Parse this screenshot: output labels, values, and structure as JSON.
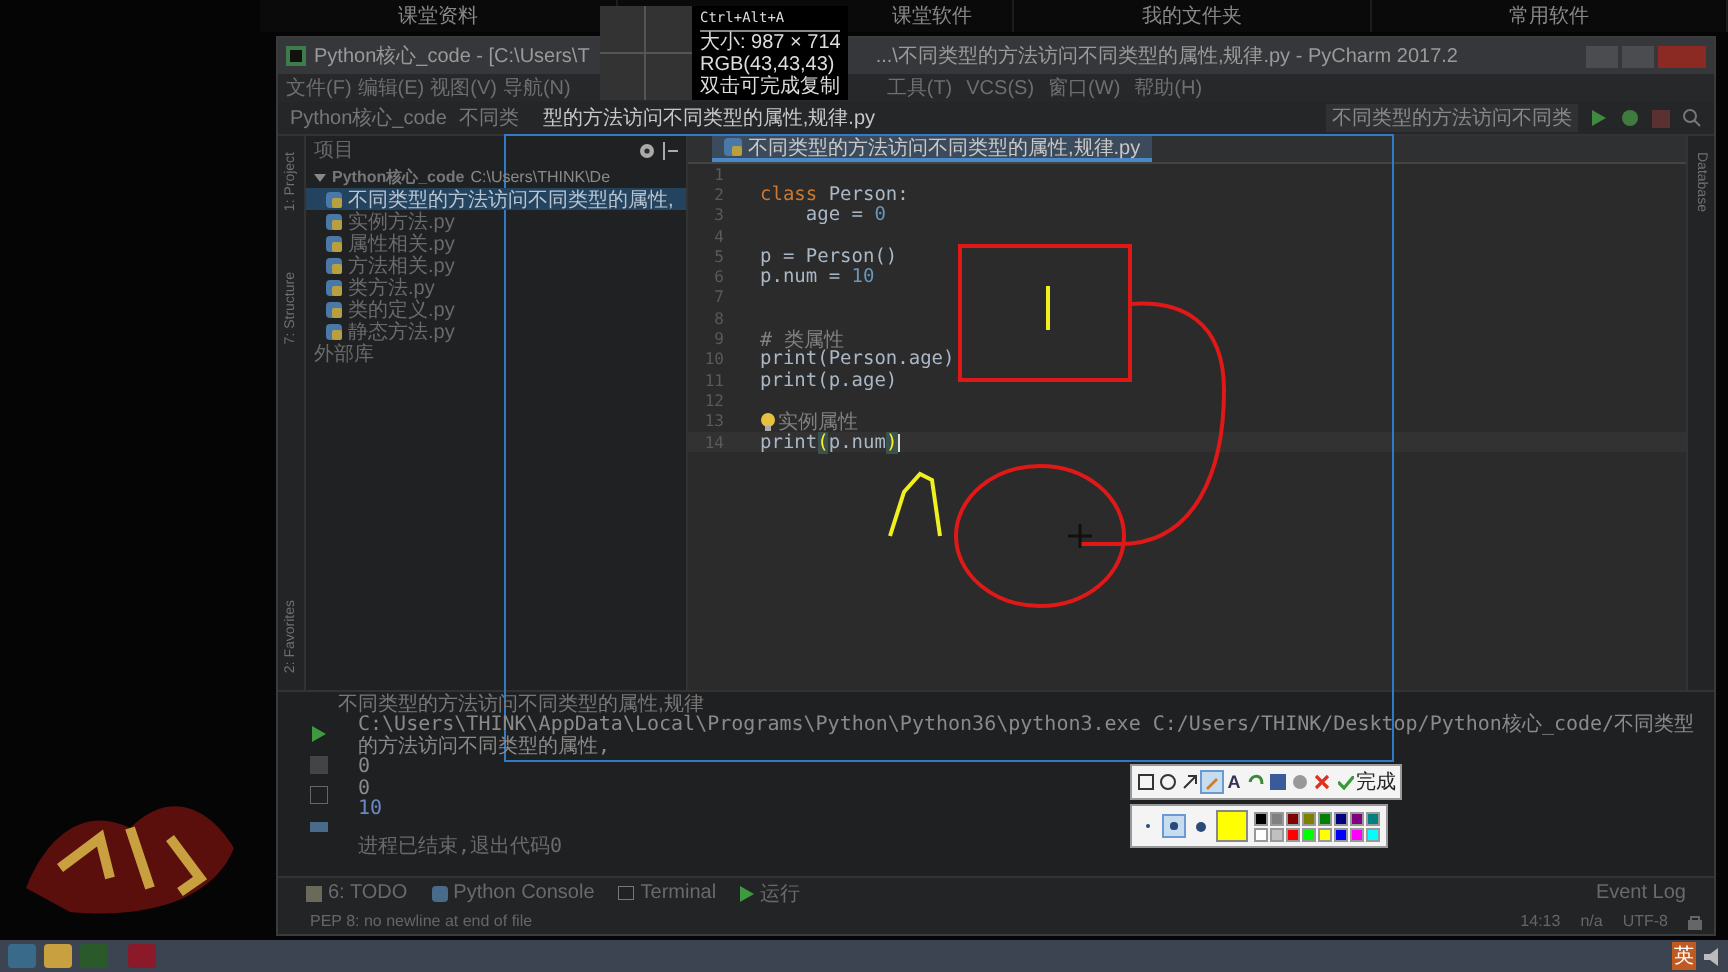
{
  "top_tabs": [
    "课堂资料",
    "课堂软件",
    "我的文件夹",
    "常用软件"
  ],
  "window": {
    "title_left": "Python核心_code - [C:\\Users\\T",
    "title_right": "...\\不同类型的方法访问不同类型的属性,规律.py - PyCharm 2017.2"
  },
  "menu_left": [
    "文件(F)",
    "编辑(E)",
    "视图(V)",
    "导航(N)"
  ],
  "menu_right": [
    "工具(T)",
    "VCS(S)",
    "窗口(W)",
    "帮助(H)"
  ],
  "nav": {
    "project": "Python核心_code",
    "file_part": "不同类",
    "file_rest": "型的方法访问不同类型的属性,规律.py",
    "run_config": "不同类型的方法访问不同类"
  },
  "capture_info": {
    "shortcut": "Ctrl+Alt+A",
    "size": "大小: 987 × 714",
    "rgb": "RGB(43,43,43)",
    "hint": "双击可完成复制"
  },
  "side_tabs_left": [
    "1: Project",
    "7: Structure"
  ],
  "side_tabs_left_bottom": [
    "2: Favorites"
  ],
  "side_tabs_right": [
    "Database"
  ],
  "project": {
    "header": "项目",
    "root": {
      "name": "Python核心_code",
      "path": "C:\\Users\\THINK\\De",
      "expanded": true,
      "children": [
        {
          "name": "不同类型的方法访问不同类型的属性,",
          "selected": true
        },
        {
          "name": "实例方法.py",
          "selected": false
        },
        {
          "name": "属性相关.py",
          "selected": false
        },
        {
          "name": "方法相关.py",
          "selected": false
        },
        {
          "name": "类方法.py",
          "selected": false
        },
        {
          "name": "类的定义.py",
          "selected": false
        },
        {
          "name": "静态方法.py",
          "selected": false
        }
      ]
    },
    "external": "外部库"
  },
  "editor": {
    "tab": "不同类型的方法访问不同类型的属性,规律.py",
    "lines": [
      {
        "n": "1",
        "current": false,
        "bulb": false
      },
      {
        "n": "2",
        "current": false,
        "bulb": false,
        "tokens": [
          {
            "t": "class",
            "kind": "kw"
          },
          {
            "t": " Person:",
            "kind": "id"
          }
        ]
      },
      {
        "n": "3",
        "current": false,
        "bulb": false,
        "tokens": [
          {
            "t": "    age = ",
            "kind": "id"
          },
          {
            "t": "0",
            "kind": "num"
          }
        ]
      },
      {
        "n": "4",
        "current": false,
        "bulb": false
      },
      {
        "n": "5",
        "current": false,
        "bulb": false,
        "tokens": [
          {
            "t": "p = Person()",
            "kind": "id"
          }
        ]
      },
      {
        "n": "6",
        "current": false,
        "bulb": false,
        "tokens": [
          {
            "t": "p.num = ",
            "kind": "id"
          },
          {
            "t": "10",
            "kind": "num"
          }
        ]
      },
      {
        "n": "7",
        "current": false,
        "bulb": false
      },
      {
        "n": "8",
        "current": false,
        "bulb": false
      },
      {
        "n": "9",
        "current": false,
        "bulb": false,
        "tokens": [
          {
            "t": "# 类属性",
            "kind": "com"
          }
        ]
      },
      {
        "n": "10",
        "current": false,
        "bulb": false,
        "tokens": [
          {
            "t": "print(Person.age)",
            "kind": "id"
          }
        ]
      },
      {
        "n": "11",
        "current": false,
        "bulb": false,
        "tokens": [
          {
            "t": "print(p.age)",
            "kind": "id"
          }
        ]
      },
      {
        "n": "12",
        "current": false,
        "bulb": false
      },
      {
        "n": "13",
        "current": false,
        "bulb": true,
        "tokens": [
          {
            "t": "实例属性",
            "kind": "com"
          }
        ]
      },
      {
        "n": "14",
        "current": true,
        "bulb": false,
        "tokens": [
          {
            "t": "print",
            "kind": "id"
          },
          {
            "t": "(",
            "kind": "match"
          },
          {
            "t": "p.num",
            "kind": "id"
          },
          {
            "t": ")",
            "kind": "match"
          }
        ]
      }
    ]
  },
  "run": {
    "title": "不同类型的方法访问不同类型的属性,规律",
    "output": [
      {
        "t": "C:\\Users\\THINK\\AppData\\Local\\Programs\\Python\\Python36\\python3.exe C:/Users/THINK/Desktop/Python核心_code/不同类型的方法访问不同类型的属性,",
        "kind": "cmd"
      },
      {
        "t": "0",
        "kind": "out"
      },
      {
        "t": "0",
        "kind": "out"
      },
      {
        "t": "10",
        "kind": "num"
      },
      {
        "t": "进程已结束,退出代码0",
        "kind": "info"
      }
    ]
  },
  "capture_tools": [
    {
      "kind": "rect",
      "selected": false
    },
    {
      "kind": "ellipse",
      "selected": false
    },
    {
      "kind": "arrow",
      "selected": false
    },
    {
      "kind": "brush",
      "selected": true
    },
    {
      "kind": "text",
      "label": "A",
      "selected": false
    },
    {
      "kind": "undo",
      "selected": false
    },
    {
      "kind": "save",
      "selected": false
    },
    {
      "kind": "copy",
      "selected": false
    },
    {
      "kind": "cancel",
      "selected": false
    }
  ],
  "capture_done": "完成",
  "pen_sizes": [
    {
      "selected": false
    },
    {
      "selected": true
    },
    {
      "selected": false
    }
  ],
  "current_swatch": {
    "color": "#ffff00"
  },
  "palette": [
    {
      "color": "#000000"
    },
    {
      "color": "#808080"
    },
    {
      "color": "#800000"
    },
    {
      "color": "#808000"
    },
    {
      "color": "#008000"
    },
    {
      "color": "#000080"
    },
    {
      "color": "#800080"
    },
    {
      "color": "#008080"
    },
    {
      "color": "#ffffff"
    },
    {
      "color": "#c0c0c0"
    },
    {
      "color": "#ff0000"
    },
    {
      "color": "#00ff00"
    },
    {
      "color": "#ffff00"
    },
    {
      "color": "#0000ff"
    },
    {
      "color": "#ff00ff"
    },
    {
      "color": "#00ffff"
    }
  ],
  "tool_tabs": [
    {
      "label": "6: TODO",
      "kind": "todo"
    },
    {
      "label": "Python Console",
      "kind": "console"
    },
    {
      "label": "Terminal",
      "kind": "terminal"
    },
    {
      "label": "运行",
      "kind": "run"
    }
  ],
  "event_log": "Event Log",
  "status": {
    "message": "PEP 8: no newline at end of file",
    "position": "14:13",
    "separator": "n/a",
    "encoding": "UTF-8"
  },
  "tray": {
    "ime": "英"
  }
}
